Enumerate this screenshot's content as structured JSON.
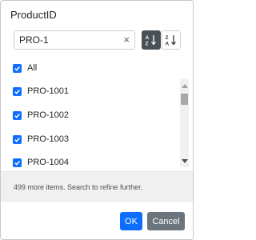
{
  "dialog": {
    "title": "ProductID",
    "search": {
      "value": "PRO-1",
      "clear_symbol": "×"
    },
    "sort": {
      "ascending_active": true
    },
    "items": [
      {
        "label": "All",
        "checked": true
      },
      {
        "label": "PRO-1001",
        "checked": true
      },
      {
        "label": "PRO-1002",
        "checked": true
      },
      {
        "label": "PRO-1003",
        "checked": true
      },
      {
        "label": "PRO-1004",
        "checked": true
      }
    ],
    "info_text": "499 more items. Search to refine further.",
    "ok_label": "OK",
    "cancel_label": "Cancel"
  },
  "colors": {
    "primary": "#0d6efd",
    "secondary": "#6c757d",
    "sort_active": "#495057"
  }
}
